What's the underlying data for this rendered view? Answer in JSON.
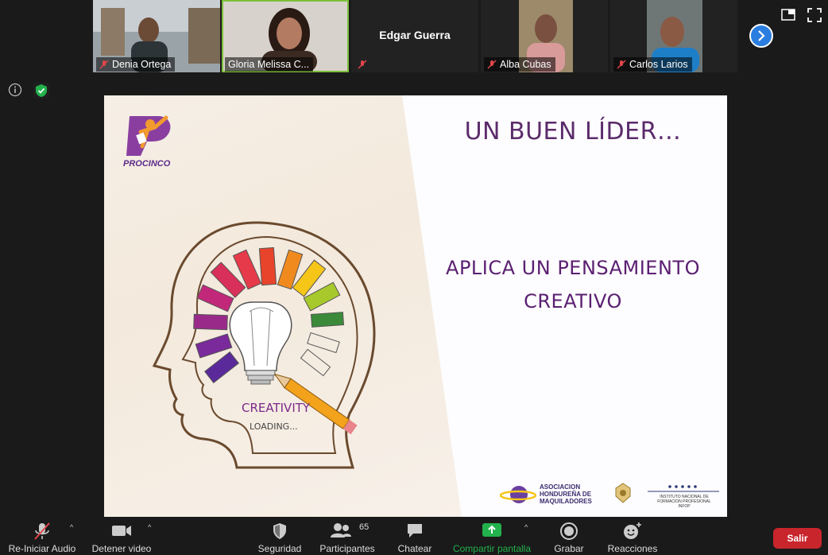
{
  "participants": [
    {
      "name": "Denia Ortega"
    },
    {
      "name": "Gloria Melissa C..."
    },
    {
      "name": "Edgar Guerra"
    },
    {
      "name": "Alba Cubas"
    },
    {
      "name": "Carlos Larios"
    }
  ],
  "slide": {
    "logo_text": "PROCINCO",
    "title": "UN BUEN LÍDER…",
    "body_line1": "APLICA UN PENSAMIENTO",
    "body_line2": "CREATIVO",
    "illustration_text1": "CREATIVITY",
    "illustration_text2": "LOADING...",
    "footer_org1_line1": "ASOCIACION",
    "footer_org1_line2": "HONDUREÑA DE",
    "footer_org1_line3": "MAQUILADORES",
    "footer_org2_line1": "INSTITUTO NACIONAL DE",
    "footer_org2_line2": "FORMACION PROFESIONAL",
    "footer_org2_line3": "INFOP"
  },
  "toolbar": {
    "audio": "Re-Iniciar Audio",
    "video": "Detener video",
    "security": "Seguridad",
    "participants": "Participantes",
    "participants_count": "65",
    "chat": "Chatear",
    "share": "Compartir pantalla",
    "record": "Grabar",
    "reactions": "Reacciones",
    "leave": "Salir"
  },
  "colors": {
    "accent_green": "#7cbf3a",
    "share_green": "#22b14c",
    "leave_red": "#c8252c",
    "slide_purple": "#5b2072",
    "next_blue": "#2b7ee0"
  }
}
